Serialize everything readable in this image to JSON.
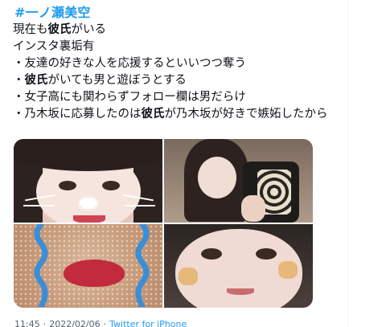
{
  "tweet": {
    "hashtag": "#一ノ瀬美空",
    "lines": [
      {
        "pre": "現在も",
        "bold": "彼氏",
        "post": "がいる"
      },
      {
        "pre": "インスタ裏垢有",
        "bold": "",
        "post": ""
      },
      {
        "pre": "・友達の好きな人を応援するといいつつ奪う",
        "bold": "",
        "post": ""
      },
      {
        "pre": "・",
        "bold": "彼氏",
        "post": "がいても男と遊ぼうとする"
      },
      {
        "pre": "・女子高にも関わらずフォロー欄は男だらけ",
        "bold": "",
        "post": ""
      },
      {
        "pre": "・乃木坂に応募したのは",
        "bold": "彼氏",
        "post": "が乃木坂が好きで嫉妬したから"
      }
    ],
    "time": "11:45",
    "date": "2022/02/06",
    "dot": "·",
    "source": "Twitter for iPhone"
  },
  "colors": {
    "accent": "#1d9bf0",
    "text": "#0f1419",
    "muted": "#536471"
  }
}
